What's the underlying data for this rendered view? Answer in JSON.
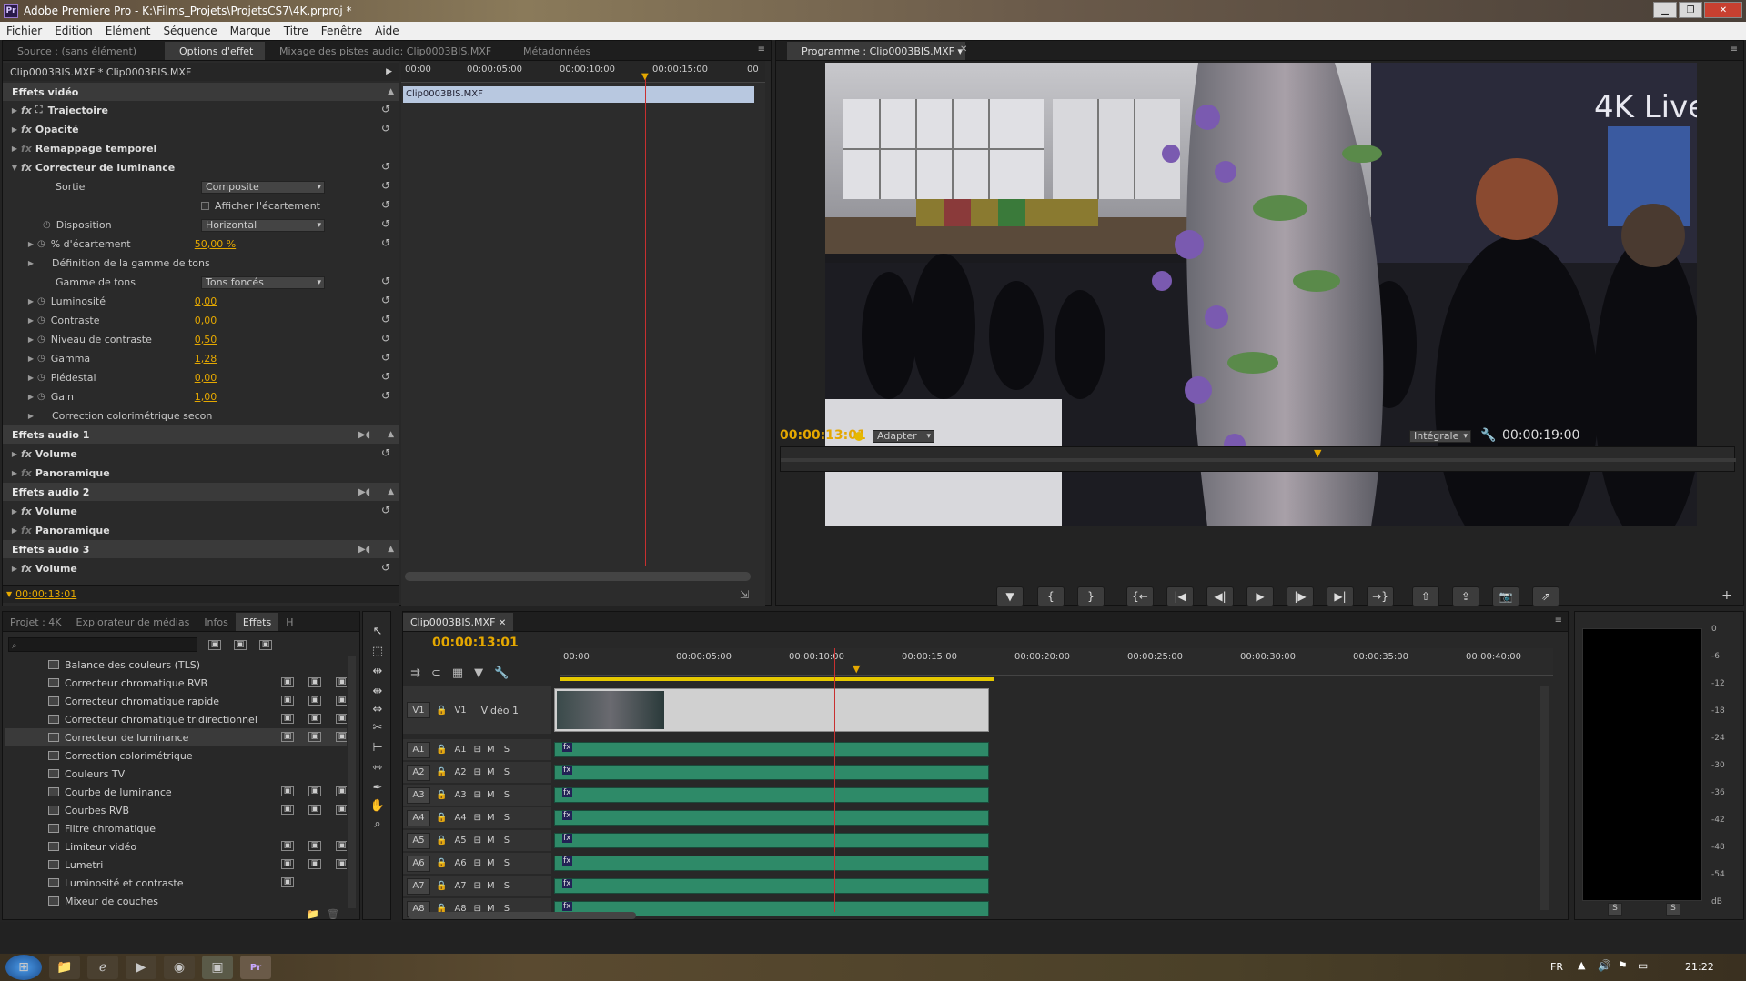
{
  "window": {
    "title": "Adobe Premiere Pro - K:\\Films_Projets\\ProjetsCS7\\4K.prproj *",
    "app_badge": "Pr"
  },
  "menu": [
    "Fichier",
    "Edition",
    "Elément",
    "Séquence",
    "Marque",
    "Titre",
    "Fenêtre",
    "Aide"
  ],
  "left_panel": {
    "tabs": [
      "Source : (sans élément)",
      "Options d'effet",
      "Mixage des pistes audio: Clip0003BIS.MXF",
      "Métadonnées"
    ],
    "active_tab": "Options d'effet",
    "clip_header": "Clip0003BIS.MXF * Clip0003BIS.MXF",
    "mini_timeline": {
      "ticks": [
        "00:00",
        "00:00:05:00",
        "00:00:10:00",
        "00:00:15:00",
        "00"
      ],
      "clip_label": "Clip0003BIS.MXF"
    },
    "sections": {
      "video": "Effets vidéo",
      "audio1": "Effets audio 1",
      "audio2": "Effets audio 2",
      "audio3": "Effets audio 3"
    },
    "effects": {
      "trajectoire": "Trajectoire",
      "opacite": "Opacité",
      "remappage": "Remappage temporel",
      "luminance": "Correcteur de luminance",
      "sortie_label": "Sortie",
      "sortie_value": "Composite",
      "afficher": "Afficher l'écartement",
      "disposition_label": "Disposition",
      "disposition_value": "Horizontal",
      "ecartement_label": "% d'écartement",
      "ecartement_value": "50,00 %",
      "definition": "Définition de la gamme de tons",
      "gamme_label": "Gamme de tons",
      "gamme_value": "Tons foncés",
      "luminosite_label": "Luminosité",
      "luminosite_value": "0,00",
      "contraste_label": "Contraste",
      "contraste_value": "0,00",
      "niveau_label": "Niveau de contraste",
      "niveau_value": "0,50",
      "gamma_label": "Gamma",
      "gamma_value": "1,28",
      "piedestal_label": "Piédestal",
      "piedestal_value": "0,00",
      "gain_label": "Gain",
      "gain_value": "1,00",
      "correction": "Correction colorimétrique secon",
      "volume": "Volume",
      "panoramique": "Panoramique"
    },
    "timecode": "00:00:13:01"
  },
  "program": {
    "tab": "Programme : Clip0003BIS.MXF",
    "timecode": "00:00:13:01",
    "fit": "Adapter",
    "quality": "Intégrale",
    "duration": "00:00:19:00",
    "video_overlay_text": "4K Live"
  },
  "project_panel": {
    "tabs": [
      "Projet : 4K",
      "Explorateur de médias",
      "Infos",
      "Effets",
      "H"
    ],
    "active_tab": "Effets",
    "search_placeholder": "",
    "items": [
      {
        "name": "Balance des couleurs (TLS)",
        "badges": 0
      },
      {
        "name": "Correcteur chromatique RVB",
        "badges": 3
      },
      {
        "name": "Correcteur chromatique rapide",
        "badges": 3
      },
      {
        "name": "Correcteur chromatique tridirectionnel",
        "badges": 3
      },
      {
        "name": "Correcteur de luminance",
        "badges": 3
      },
      {
        "name": "Correction colorimétrique",
        "badges": 0
      },
      {
        "name": "Couleurs TV",
        "badges": 0
      },
      {
        "name": "Courbe de luminance",
        "badges": 3
      },
      {
        "name": "Courbes RVB",
        "badges": 3
      },
      {
        "name": "Filtre chromatique",
        "badges": 0
      },
      {
        "name": "Limiteur vidéo",
        "badges": 3
      },
      {
        "name": "Lumetri",
        "badges": 3
      },
      {
        "name": "Luminosité et contraste",
        "badges": 1
      },
      {
        "name": "Mixeur de couches",
        "badges": 0
      }
    ]
  },
  "timeline": {
    "tab": "Clip0003BIS.MXF",
    "timecode": "00:00:13:01",
    "ticks": [
      "00:00",
      "00:00:05:00",
      "00:00:10:00",
      "00:00:15:00",
      "00:00:20:00",
      "00:00:25:00",
      "00:00:30:00",
      "00:00:35:00",
      "00:00:40:00"
    ],
    "video_track": {
      "id": "V1",
      "name": "Vidéo 1"
    },
    "audio_tracks": [
      "A1",
      "A2",
      "A3",
      "A4",
      "A5",
      "A6",
      "A7",
      "A8"
    ],
    "mute": "M",
    "solo": "S"
  },
  "meter": {
    "scale": [
      "0",
      "-6",
      "-12",
      "-18",
      "-24",
      "-30",
      "-36",
      "-42",
      "-48",
      "-54",
      "dB"
    ],
    "solo_left": "S",
    "solo_right": "S"
  },
  "taskbar": {
    "lang": "FR",
    "clock": "21:22"
  },
  "colors": {
    "accent": "#e5a800",
    "audio_clip": "#2e8a68",
    "playhead": "#c83030"
  }
}
